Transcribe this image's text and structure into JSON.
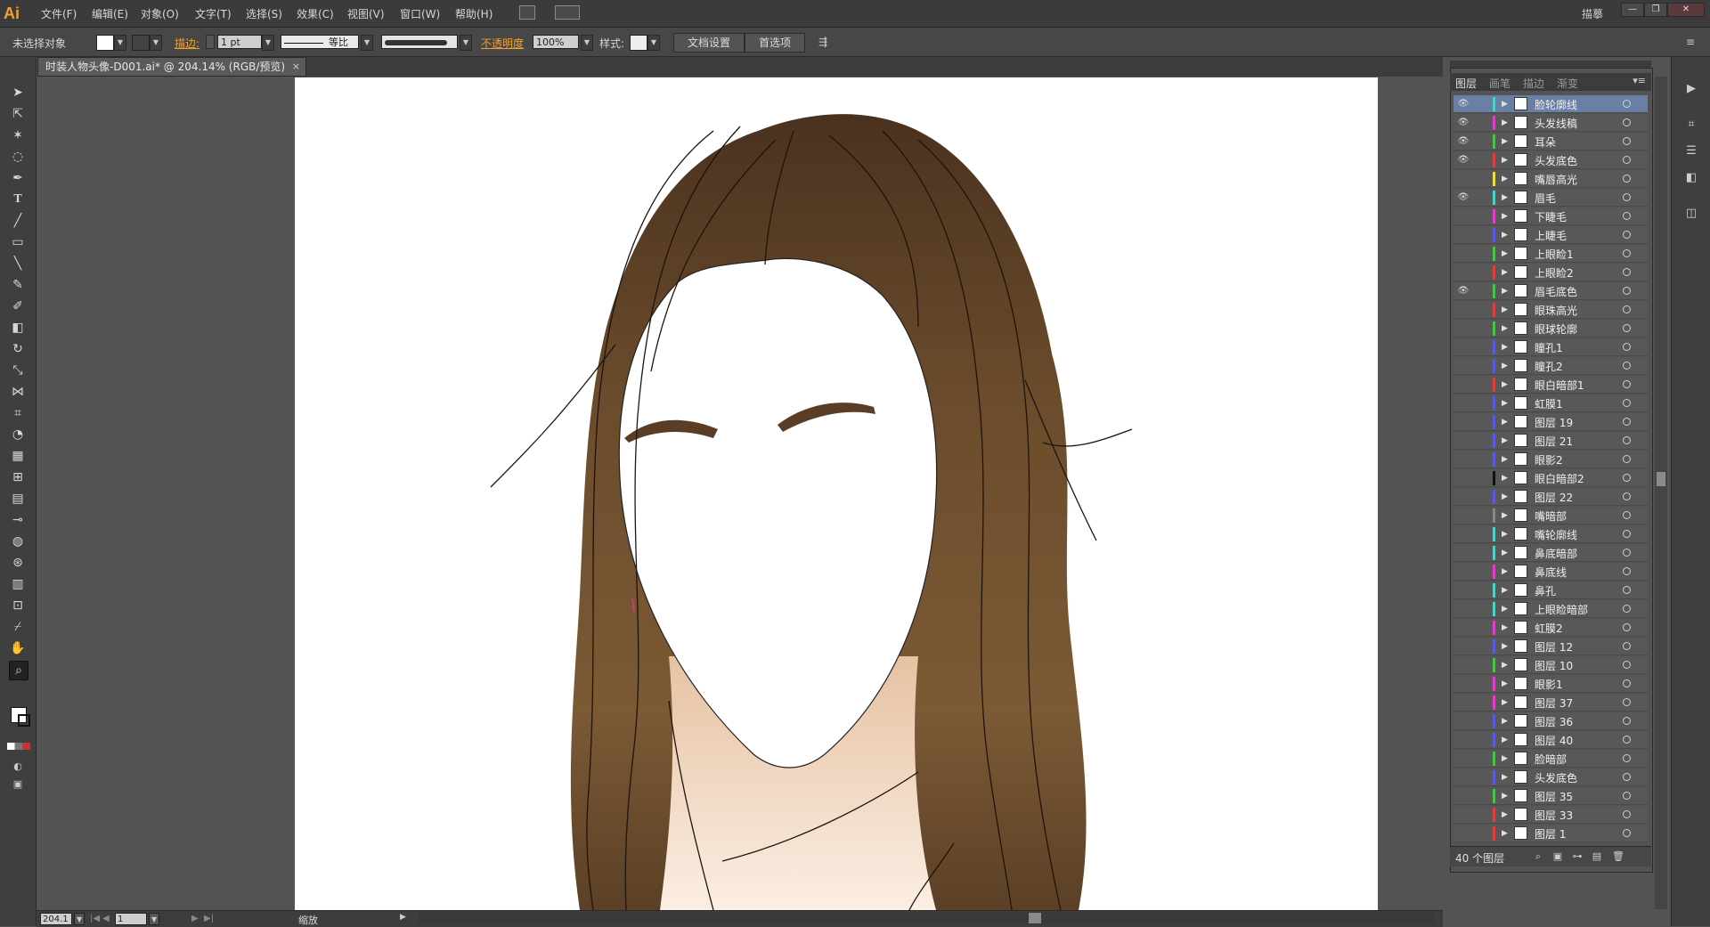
{
  "app": {
    "logo_text": "Ai",
    "menus": [
      "文件(F)",
      "编辑(E)",
      "对象(O)",
      "文字(T)",
      "选择(S)",
      "效果(C)",
      "视图(V)",
      "窗口(W)",
      "帮助(H)"
    ],
    "workspace": "描摹",
    "window_controls": [
      "—",
      "❐",
      "✕"
    ]
  },
  "control_bar": {
    "selection_status": "未选择对象",
    "stroke_label": "描边:",
    "stroke_weight": "1 pt",
    "stroke_profile": "等比",
    "opacity_label": "不透明度",
    "opacity_value": "100%",
    "style_label": "样式:",
    "doc_setup_button": "文档设置",
    "preferences_button": "首选项"
  },
  "document": {
    "tab_title": "时装人物头像-D001.ai* @ 204.14% (RGB/预览)",
    "tab_close": "×"
  },
  "status_bar": {
    "zoom": "204.1",
    "artboard_number": "1",
    "status_text": "缩放"
  },
  "layers_panel": {
    "tabs": [
      "图层",
      "画笔",
      "描边",
      "渐变"
    ],
    "layer_count": "40 个图层",
    "layers": [
      {
        "name": "脸轮廓线",
        "color": "#4fd1c5",
        "visible": true,
        "selected": true
      },
      {
        "name": "头发线稿",
        "color": "#e040c8",
        "visible": true
      },
      {
        "name": "耳朵",
        "color": "#49c24a",
        "visible": true
      },
      {
        "name": "头发底色",
        "color": "#e04040",
        "visible": true
      },
      {
        "name": "嘴唇高光",
        "color": "#e8e040",
        "visible": false
      },
      {
        "name": "眉毛",
        "color": "#4fd1c5",
        "visible": true
      },
      {
        "name": "下睫毛",
        "color": "#e040c8",
        "visible": false
      },
      {
        "name": "上睫毛",
        "color": "#5a5ae0",
        "visible": false
      },
      {
        "name": "上眼睑1",
        "color": "#49c24a",
        "visible": false
      },
      {
        "name": "上眼睑2",
        "color": "#e04040",
        "visible": false
      },
      {
        "name": "眉毛底色",
        "color": "#49c24a",
        "visible": true
      },
      {
        "name": "眼珠高光",
        "color": "#e04040",
        "visible": false
      },
      {
        "name": "眼球轮廓",
        "color": "#49c24a",
        "visible": false
      },
      {
        "name": "瞳孔1",
        "color": "#5a5ae0",
        "visible": false
      },
      {
        "name": "瞳孔2",
        "color": "#5a5ae0",
        "visible": false
      },
      {
        "name": "眼白暗部1",
        "color": "#e04040",
        "visible": false
      },
      {
        "name": "虹膜1",
        "color": "#5a5ae0",
        "visible": false
      },
      {
        "name": "图层 19",
        "color": "#5a5ae0",
        "visible": false
      },
      {
        "name": "图层 21",
        "color": "#5a5ae0",
        "visible": false
      },
      {
        "name": "眼影2",
        "color": "#5a5ae0",
        "visible": false
      },
      {
        "name": "眼白暗部2",
        "color": "#111111",
        "visible": false
      },
      {
        "name": "图层 22",
        "color": "#5a5ae0",
        "visible": false
      },
      {
        "name": "嘴暗部",
        "color": "#888888",
        "visible": false
      },
      {
        "name": "嘴轮廓线",
        "color": "#4fd1c5",
        "visible": false
      },
      {
        "name": "鼻底暗部",
        "color": "#4fd1c5",
        "visible": false
      },
      {
        "name": "鼻底线",
        "color": "#e040c8",
        "visible": false
      },
      {
        "name": "鼻孔",
        "color": "#4fd1c5",
        "visible": false
      },
      {
        "name": "上眼睑暗部",
        "color": "#4fd1c5",
        "visible": false
      },
      {
        "name": "虹膜2",
        "color": "#e040c8",
        "visible": false
      },
      {
        "name": "图层 12",
        "color": "#5a5ae0",
        "visible": false
      },
      {
        "name": "图层 10",
        "color": "#49c24a",
        "visible": false
      },
      {
        "name": "眼影1",
        "color": "#e040c8",
        "visible": false
      },
      {
        "name": "图层 37",
        "color": "#e040c8",
        "visible": false
      },
      {
        "name": "图层 36",
        "color": "#5a5ae0",
        "visible": false
      },
      {
        "name": "图层 40",
        "color": "#5a5ae0",
        "visible": false
      },
      {
        "name": "脸暗部",
        "color": "#49c24a",
        "visible": false
      },
      {
        "name": "头发底色",
        "color": "#5a5ae0",
        "visible": false
      },
      {
        "name": "图层 35",
        "color": "#49c24a",
        "visible": false
      },
      {
        "name": "图层 33",
        "color": "#e04040",
        "visible": false
      },
      {
        "name": "图层 1",
        "color": "#e04040",
        "visible": false
      }
    ]
  },
  "icons": {
    "eye": "eye-icon",
    "expand": "expand-triangle-icon",
    "target": "target-circle-icon"
  }
}
